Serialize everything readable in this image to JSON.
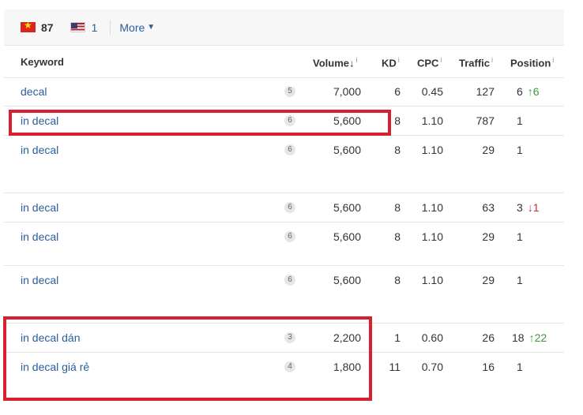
{
  "filters": {
    "vn_count": "87",
    "us_count": "1",
    "more_label": "More",
    "more_caret": "▼"
  },
  "columns": {
    "keyword": "Keyword",
    "volume": "Volume",
    "volume_sort": "↓",
    "kd": "KD",
    "cpc": "CPC",
    "traffic": "Traffic",
    "position": "Position",
    "info": "i"
  },
  "rows": [
    {
      "keyword": "decal",
      "badge": "5",
      "volume": "7,000",
      "kd": "6",
      "cpc": "0.45",
      "traffic": "127",
      "position": "6",
      "change": "↑6",
      "dir": "up"
    },
    {
      "keyword": "in decal",
      "badge": "6",
      "volume": "5,600",
      "kd": "8",
      "cpc": "1.10",
      "traffic": "787",
      "position": "1",
      "change": "",
      "dir": ""
    },
    {
      "keyword": "in decal",
      "badge": "6",
      "volume": "5,600",
      "kd": "8",
      "cpc": "1.10",
      "traffic": "29",
      "position": "1",
      "change": "",
      "dir": ""
    },
    {
      "keyword": "in decal",
      "badge": "6",
      "volume": "5,600",
      "kd": "8",
      "cpc": "1.10",
      "traffic": "63",
      "position": "3",
      "change": "↓1",
      "dir": "down"
    },
    {
      "keyword": "in decal",
      "badge": "6",
      "volume": "5,600",
      "kd": "8",
      "cpc": "1.10",
      "traffic": "29",
      "position": "1",
      "change": "",
      "dir": ""
    },
    {
      "keyword": "in decal",
      "badge": "6",
      "volume": "5,600",
      "kd": "8",
      "cpc": "1.10",
      "traffic": "29",
      "position": "1",
      "change": "",
      "dir": ""
    },
    {
      "keyword": "in decal dán",
      "badge": "3",
      "volume": "2,200",
      "kd": "1",
      "cpc": "0.60",
      "traffic": "26",
      "position": "18",
      "change": "↑22",
      "dir": "up"
    },
    {
      "keyword": "in decal giá rẻ",
      "badge": "4",
      "volume": "1,800",
      "kd": "11",
      "cpc": "0.70",
      "traffic": "16",
      "position": "1",
      "change": "",
      "dir": ""
    }
  ],
  "colors": {
    "link": "#2b5e9c",
    "highlight": "#d8202f",
    "up": "#3d9a3d",
    "down": "#c9302c"
  }
}
